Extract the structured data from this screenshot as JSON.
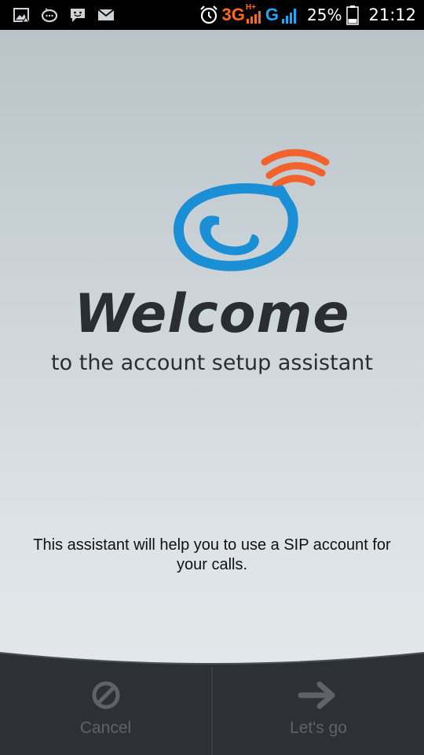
{
  "status_bar": {
    "network_3g": "3G",
    "network_hplus": "H+",
    "network_g": "G",
    "battery_percent": "25%",
    "time": "21:12",
    "icons": [
      "gallery-icon",
      "chat-bubble-icon",
      "messenger-icon",
      "mail-icon",
      "alarm-icon",
      "signal-icon",
      "battery-icon"
    ]
  },
  "welcome": {
    "title": "Welcome",
    "subtitle": "to the account setup assistant",
    "description": "This assistant will help you to use a SIP account for your calls."
  },
  "logo": {
    "icon": "phone-speech-bubble-logo",
    "colors": {
      "blue": "#1a8fd6",
      "orange": "#f2622e"
    }
  },
  "buttons": {
    "cancel_label": "Cancel",
    "next_label": "Let's go",
    "cancel_icon": "no-entry-icon",
    "next_icon": "arrow-right-icon"
  },
  "colors": {
    "status_bar_bg": "#000000",
    "bottom_bar_bg": "#2d3135",
    "disabled_text": "#5f6367"
  }
}
